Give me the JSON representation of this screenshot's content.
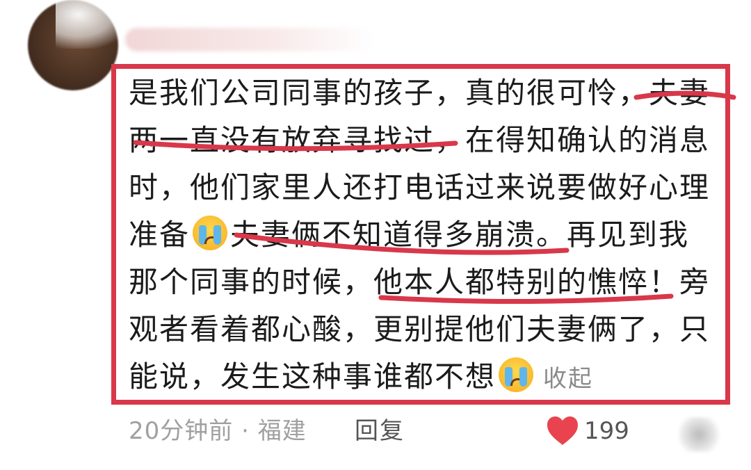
{
  "comment": {
    "lines": [
      "是我们公司同事的孩子，真的很可怜，夫妻",
      "两一直没有放弃寻找过，在得知确认的消息",
      "时，他们家里人还打电话过来说要做好心理",
      "准备",
      "夫妻俩不知道得多崩溃。再见到我",
      "那个同事的时候，他本人都特别的憔悴！旁",
      "观者看着都心酸，更别提他们夫妻俩了，只",
      "能说，发生这种事谁都不想"
    ],
    "collapse_label": "收起",
    "emoji": "crying-face"
  },
  "meta": {
    "time": "20分钟前",
    "separator": "·",
    "location": "福建",
    "reply_label": "回复",
    "like_count": "199"
  },
  "colors": {
    "highlight": "#d8384a",
    "like": "#e8434f"
  }
}
